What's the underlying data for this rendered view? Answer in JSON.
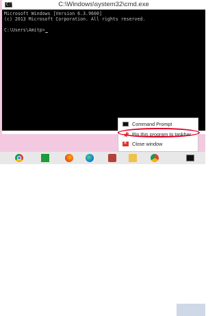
{
  "window": {
    "title": "C:\\Windows\\system32\\cmd.exe",
    "icon": "cmd-icon"
  },
  "console": {
    "lines": [
      "Microsoft Windows [Version 6.3.9600]",
      "(c) 2013 Microsoft Corporation. All rights reserved."
    ],
    "prompt": "C:\\Users\\Amitp>"
  },
  "context_menu": {
    "items": [
      {
        "label": "Command Prompt",
        "icon": "cmd-icon"
      },
      {
        "label": "Pin this program to taskbar",
        "icon": "pin-icon"
      },
      {
        "label": "Close window",
        "icon": "close-icon"
      }
    ],
    "highlight_color": "#e00028"
  },
  "taskbar": {
    "icons": [
      "chrome-icon",
      "store-icon",
      "firefox-icon",
      "edge-icon",
      "app-icon",
      "folder-icon",
      "chrome-icon",
      "cmd-icon"
    ]
  }
}
